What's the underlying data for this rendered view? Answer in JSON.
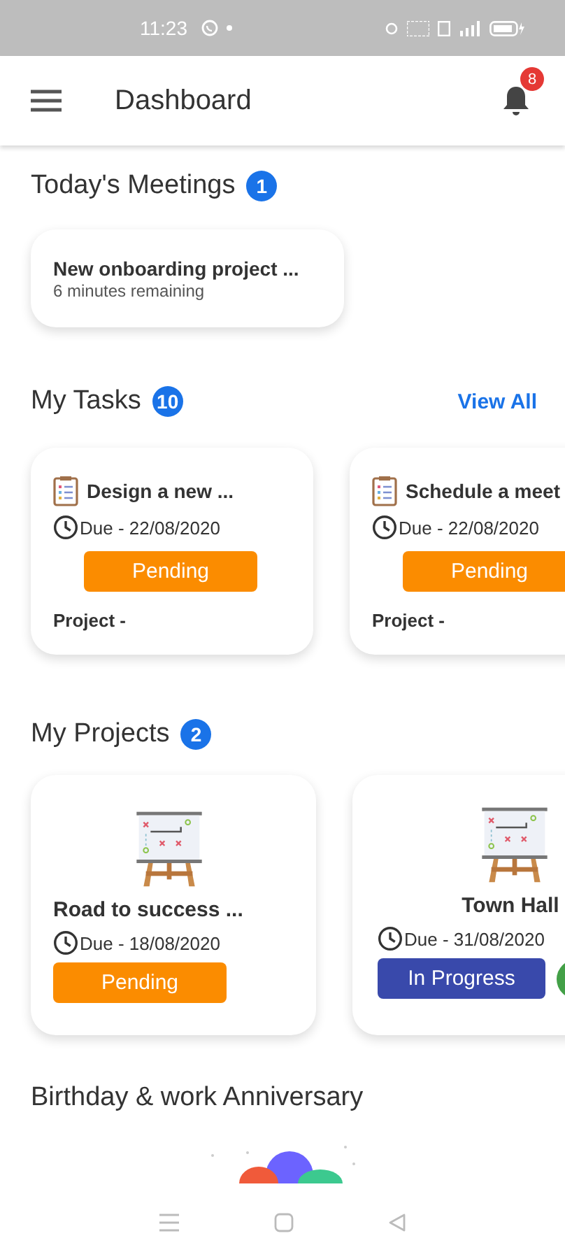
{
  "status_bar": {
    "time": "11:23"
  },
  "app_bar": {
    "title": "Dashboard",
    "notification_count": "8"
  },
  "meetings": {
    "title": "Today's Meetings",
    "count": "1",
    "items": [
      {
        "title": "New onboarding project ...",
        "subtitle": "6 minutes remaining"
      }
    ]
  },
  "tasks": {
    "title": "My Tasks",
    "count": "10",
    "link": "View All",
    "items": [
      {
        "title": "Design a new ...",
        "due": "Due - 22/08/2020",
        "status": "Pending",
        "kind": "pending",
        "project": "Project -"
      },
      {
        "title": "Schedule a meet",
        "due": "Due - 22/08/2020",
        "status": "Pending",
        "kind": "pending",
        "project": "Project -"
      }
    ]
  },
  "projects": {
    "title": "My Projects",
    "count": "2",
    "items": [
      {
        "title": "Road to success ...",
        "due": "Due - 18/08/2020",
        "status": "Pending",
        "kind": "pending"
      },
      {
        "title": "Town Hall",
        "due": "Due - 31/08/2020",
        "status": "In Progress",
        "kind": "in_progress"
      }
    ]
  },
  "birthdays": {
    "title": "Birthday & work Anniversary"
  }
}
